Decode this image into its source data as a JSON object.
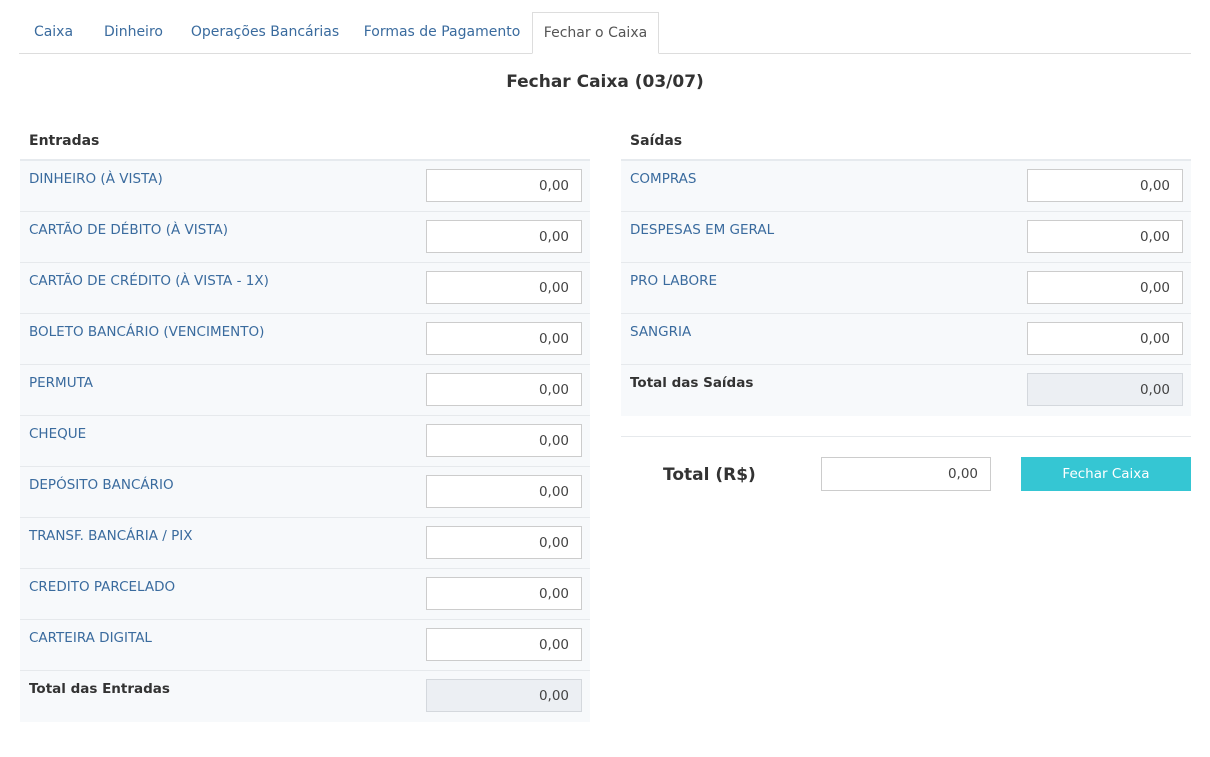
{
  "tabs": [
    {
      "label": "Caixa"
    },
    {
      "label": "Dinheiro"
    },
    {
      "label": "Operações Bancárias"
    },
    {
      "label": "Formas de Pagamento"
    },
    {
      "label": "Fechar o Caixa",
      "active": true
    }
  ],
  "title": "Fechar Caixa (03/07)",
  "entradas": {
    "heading": "Entradas",
    "rows": [
      {
        "label": "DINHEIRO (À VISTA)",
        "value": "0,00"
      },
      {
        "label": "CARTÃO DE DÉBITO (À VISTA)",
        "value": "0,00"
      },
      {
        "label": "CARTÃO DE CRÉDITO (À VISTA - 1X)",
        "value": "0,00"
      },
      {
        "label": "BOLETO BANCÁRIO (VENCIMENTO)",
        "value": "0,00"
      },
      {
        "label": "PERMUTA",
        "value": "0,00"
      },
      {
        "label": "CHEQUE",
        "value": "0,00"
      },
      {
        "label": "DEPÓSITO BANCÁRIO",
        "value": "0,00"
      },
      {
        "label": "TRANSF. BANCÁRIA / PIX",
        "value": "0,00"
      },
      {
        "label": "CREDITO PARCELADO",
        "value": "0,00"
      },
      {
        "label": "CARTEIRA DIGITAL",
        "value": "0,00"
      }
    ],
    "total_label": "Total das Entradas",
    "total_value": "0,00"
  },
  "saidas": {
    "heading": "Saídas",
    "rows": [
      {
        "label": "COMPRAS",
        "value": "0,00"
      },
      {
        "label": "DESPESAS EM GERAL",
        "value": "0,00"
      },
      {
        "label": "PRO LABORE",
        "value": "0,00"
      },
      {
        "label": "SANGRIA",
        "value": "0,00"
      }
    ],
    "total_label": "Total das Saídas",
    "total_value": "0,00"
  },
  "summary": {
    "total_label": "Total (R$)",
    "total_value": "0,00",
    "button_label": "Fechar Caixa"
  },
  "colors": {
    "accent": "#35c6d3",
    "link": "#3a6b9e"
  }
}
